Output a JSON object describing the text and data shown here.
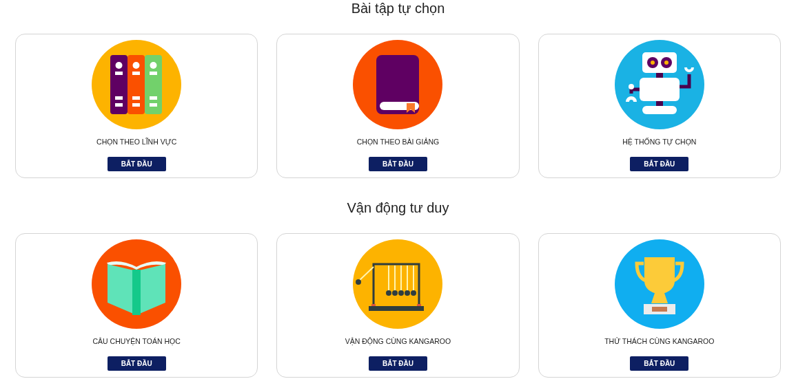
{
  "sections": [
    {
      "title": "Bài tập tự chọn",
      "cards": [
        {
          "label": "CHỌN THEO LĨNH VỰC",
          "button": "BẮT ĐẦU"
        },
        {
          "label": "CHỌN THEO BÀI GIẢNG",
          "button": "BẮT ĐẦU"
        },
        {
          "label": "HỆ THỐNG TỰ CHỌN",
          "button": "BẮT ĐẦU"
        }
      ]
    },
    {
      "title": "Vận động tư duy",
      "cards": [
        {
          "label": "CÂU CHUYỆN TOÁN HỌC",
          "button": "BẮT ĐẦU"
        },
        {
          "label": "VẬN ĐỘNG CÙNG KANGAROO",
          "button": "BẮT ĐẦU"
        },
        {
          "label": "THỬ THÁCH CÙNG KANGAROO",
          "button": "BẮT ĐẦU"
        }
      ]
    }
  ]
}
